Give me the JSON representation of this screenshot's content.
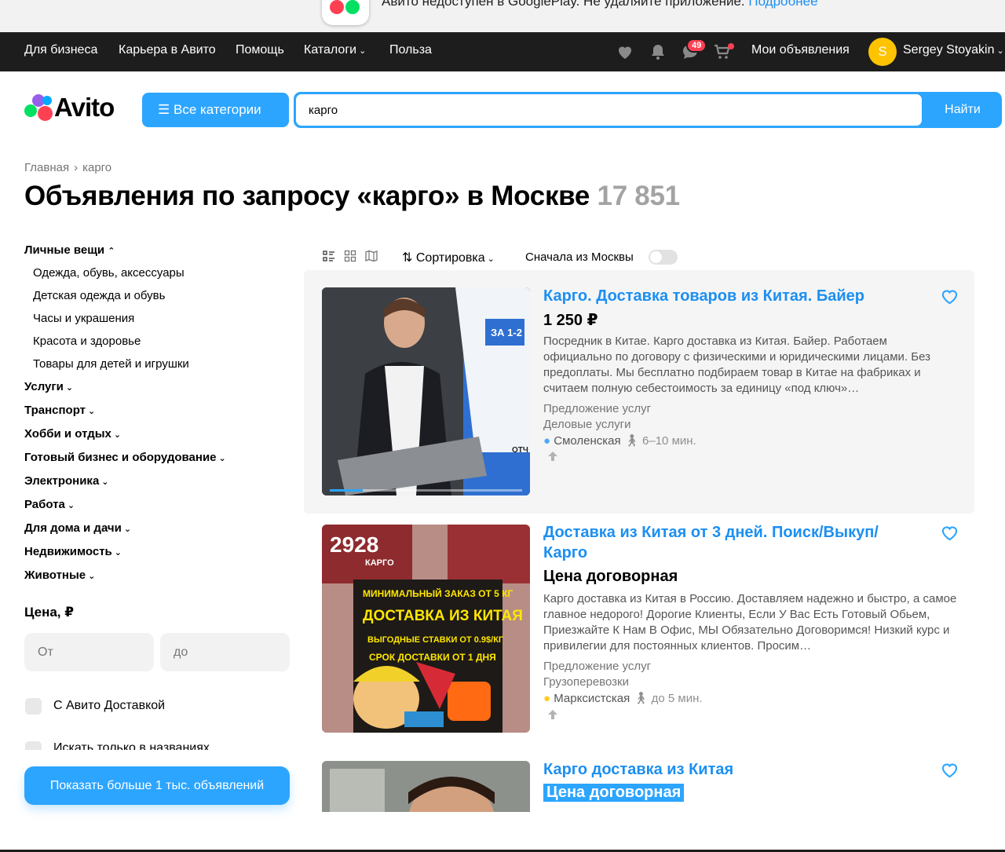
{
  "banner": {
    "text": "Авито недоступен в GooglePlay. Не удаляйте приложение.",
    "link": "Подробнее"
  },
  "topnav": {
    "links": [
      "Для бизнеса",
      "Карьера в Авито",
      "Помощь",
      "Каталоги",
      "Польза"
    ],
    "messages_badge": "49",
    "my_ads": "Мои объявления",
    "avatar_letter": "S",
    "user_name": "Sergey Stoyakin"
  },
  "header": {
    "logo_text": "Avito",
    "categories_button": "Все категории",
    "search_value": "карго",
    "search_button": "Найти"
  },
  "breadcrumb": [
    "Главная",
    "карго"
  ],
  "page": {
    "title": "Объявления по запросу «карго» в Москве",
    "count": "17 851"
  },
  "sidebar": {
    "open_category": "Личные вещи",
    "subcategories": [
      "Одежда, обувь, аксессуары",
      "Детская одежда и обувь",
      "Часы и украшения",
      "Красота и здоровье",
      "Товары для детей и игрушки"
    ],
    "categories": [
      "Услуги",
      "Транспорт",
      "Хобби и отдых",
      "Готовый бизнес и оборудование",
      "Электроника",
      "Работа",
      "Для дома и дачи",
      "Недвижимость",
      "Животные"
    ],
    "price_label": "Цена, ₽",
    "price_from": "От",
    "price_to": "до",
    "delivery_checkbox": "С Авито Доставкой",
    "titles_only_checkbox": "Искать только в названиях",
    "show_button": "Показать больше 1 тыс. объявлений"
  },
  "toolbar": {
    "sort": "Сортировка",
    "moscow_first": "Сначала из Москвы"
  },
  "listings": [
    {
      "title": "Карго. Доставка товаров из Китая. Байер",
      "price": "1 250 ₽",
      "description": "Посредник в Китае. Карго доставка из Китая. Байер. Работаем официально по договору с физическими и юридическими лицами. Без предоплаты. Мы бесплатно подбираем товар в Китае на фабриках и считаем полную себестоимость за единицу «под ключ»…",
      "type": "Предложение услуг",
      "category": "Деловые услуги",
      "metro": "Смоленская",
      "walk_time": "6–10 мин.",
      "image_text_1": "ЗА 1-2",
      "image_text_2": "ОТЧ"
    },
    {
      "title_line1": "Доставка из Китая от 3 дней. Поиск/Выкуп/",
      "title_line2": "Карго",
      "price": "Цена договорная",
      "description": "Карго доставка из Китая в Россию. Доставляем надежно и быстро, а самое главное недорого! Дорогие Клиенты, Если У Вас Есть Готовый Обьем, Приезжайте К Нам В Офис, МЫ Обязательно Договоримся! Низкий курс и привилегии для постоянных клиентов. Просим…",
      "type": "Предложение услуг",
      "category": "Грузоперевозки",
      "metro": "Марксистская",
      "walk_time": "до 5 мин.",
      "image_number": "2928",
      "image_kargo": "КАРГО",
      "image_line1": "МИНИМАЛЬНЫЙ ЗАКАЗ ОТ 5 КГ",
      "image_line2": "ДОСТАВКА ИЗ КИТАЯ",
      "image_line3": "ВЫГОДНЫЕ СТАВКИ ОТ 0.9$/КГ",
      "image_line4": "СРОК ДОСТАВКИ ОТ 1 ДНЯ"
    },
    {
      "title": "Карго доставка из Китая",
      "price": "Цена договорная"
    }
  ],
  "colors": {
    "accent": "#2ca5ff",
    "link": "#1c8ff2",
    "badge": "#ff4053",
    "avatar": "#ffc300",
    "nav_bg": "#1d1d1d"
  }
}
